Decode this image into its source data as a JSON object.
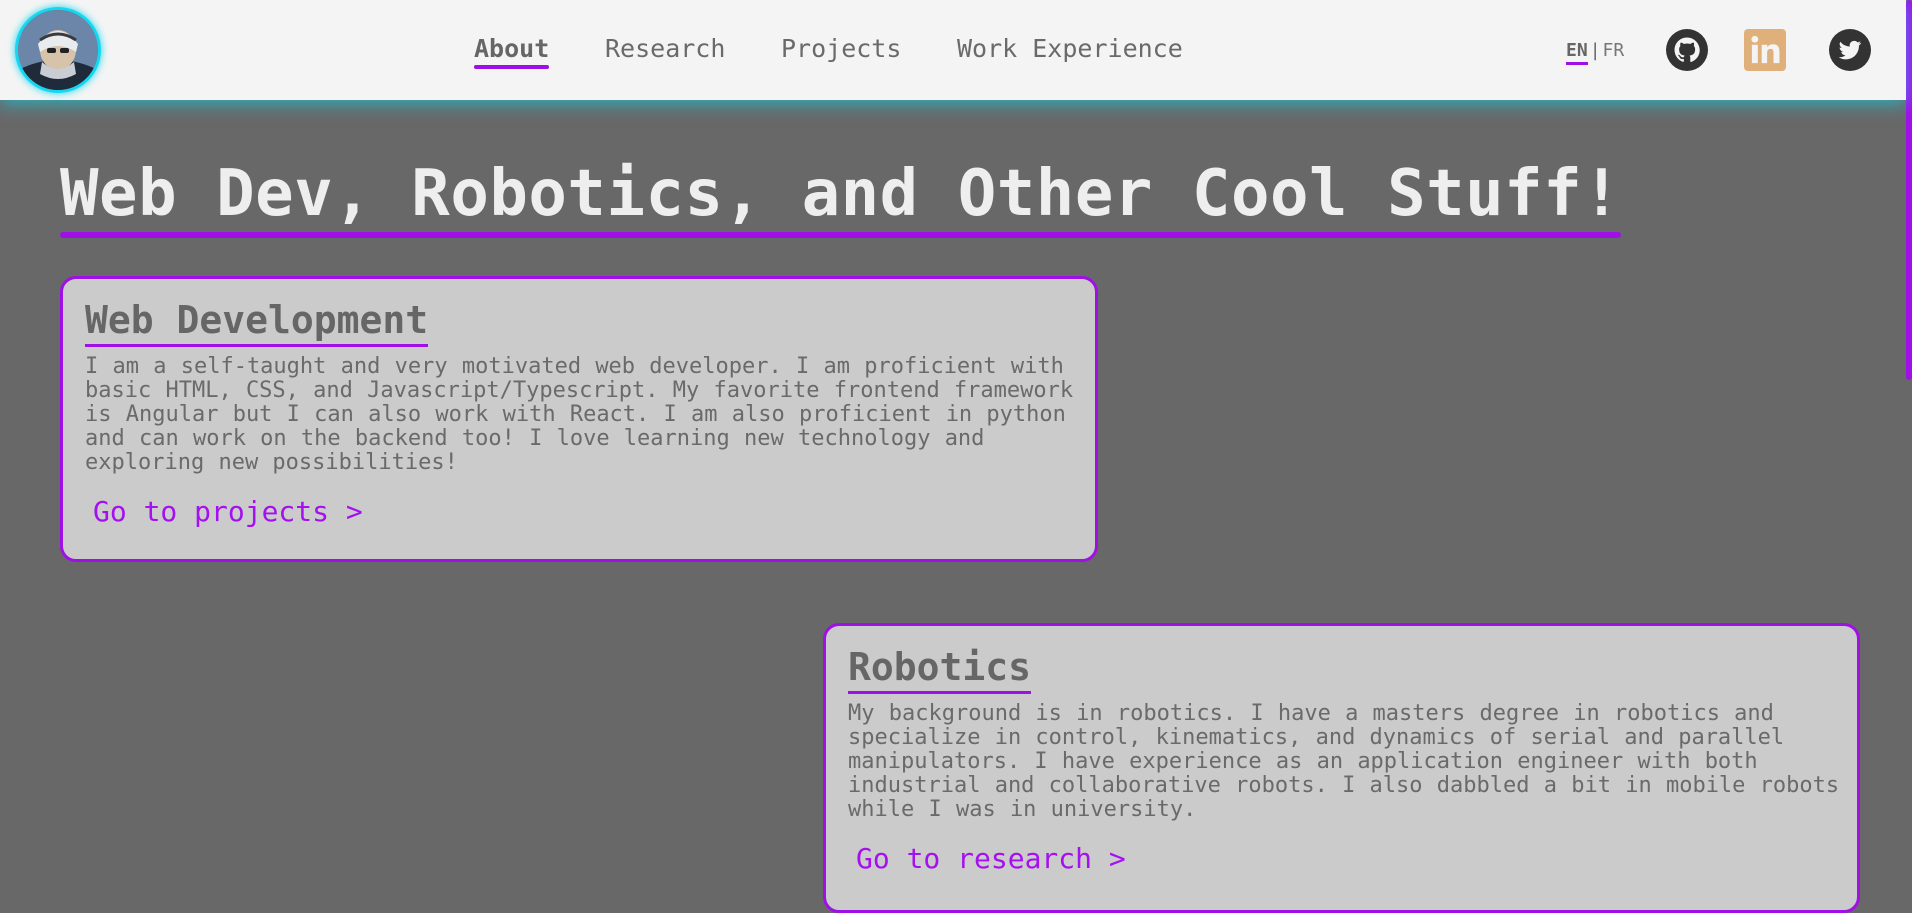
{
  "header": {
    "avatar_alt": "Profile photo",
    "nav": [
      {
        "label": "About",
        "active": true
      },
      {
        "label": "Research",
        "active": false
      },
      {
        "label": "Projects",
        "active": false
      },
      {
        "label": "Work Experience",
        "active": false
      }
    ],
    "lang": {
      "current": "EN",
      "separator": "|",
      "other": "FR"
    },
    "social": [
      {
        "name": "github-icon",
        "color": "#333333"
      },
      {
        "name": "linkedin-icon",
        "color": "#e0b07a"
      },
      {
        "name": "twitter-icon",
        "color": "#333333"
      }
    ]
  },
  "hero": {
    "title": "Web Dev, Robotics, and Other Cool Stuff!"
  },
  "cards": [
    {
      "title": "Web Development",
      "body": "I am a self-taught and very motivated web developer. I am proficient with basic HTML, CSS, and Javascript/Typescript. My favorite frontend framework is Angular but I can also work with React. I am also proficient in python and can work on the backend too! I love learning new technology and exploring new possibilities!",
      "link": "Go to projects >"
    },
    {
      "title": "Robotics",
      "body": "My background is in robotics. I have a masters degree in robotics and specialize in control, kinematics, and dynamics of serial and parallel manipulators. I have experience as an application engineer with both industrial and collaborative robots. I also dabbled a bit in mobile robots while I was in university.",
      "link": "Go to research >"
    }
  ],
  "colors": {
    "accent": "#9f10e6",
    "background": "#686868",
    "header_bg": "#f4f4f4",
    "card_bg": "#cbcbcb",
    "glow": "#12d6f0"
  }
}
